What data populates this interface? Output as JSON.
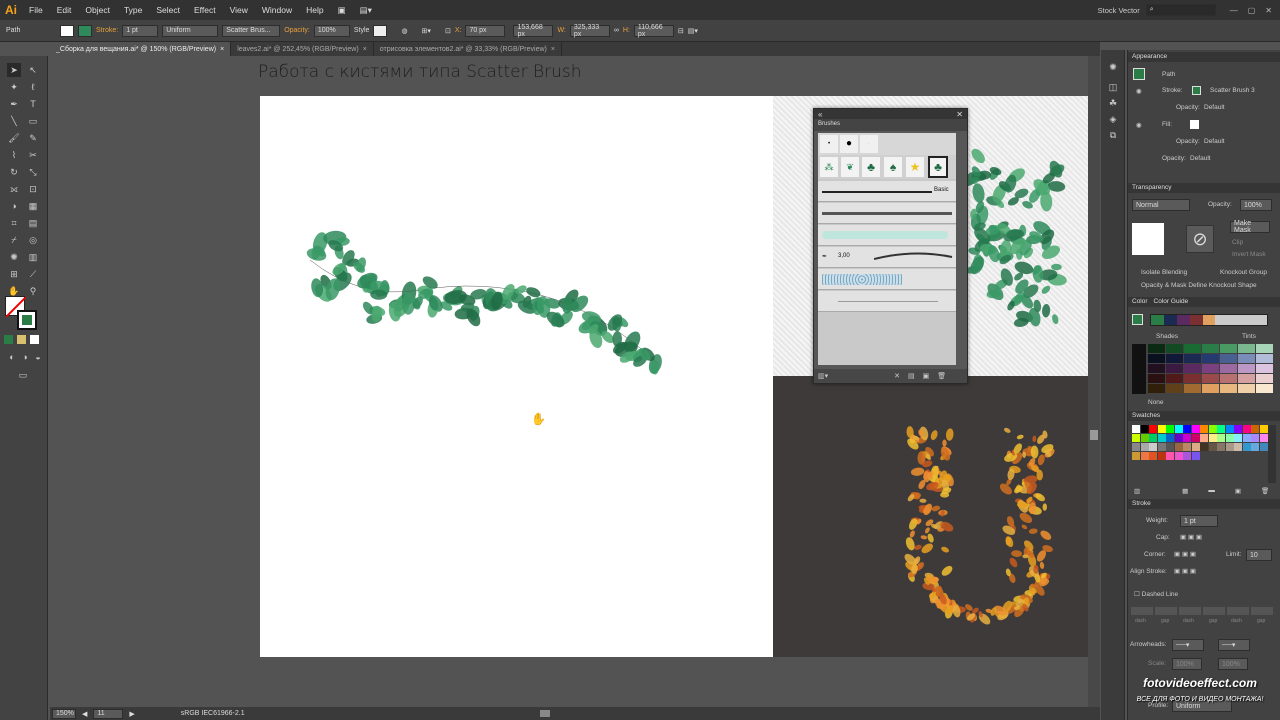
{
  "app": {
    "logo": "Ai"
  },
  "menu": [
    "File",
    "Edit",
    "Object",
    "Type",
    "Select",
    "Effect",
    "View",
    "Window",
    "Help"
  ],
  "workspace": "Stock Vector",
  "control": {
    "object_type": "Path",
    "stroke_label": "Stroke:",
    "stroke_weight": "1 pt",
    "profile": "Uniform",
    "brush": "Scatter Brus...",
    "opacity_label": "Opacity:",
    "opacity": "100%",
    "style_label": "Style",
    "x_label": "X:",
    "x": "70 px",
    "y": "153,668 px",
    "w_label": "W:",
    "w": "325,333 px",
    "h_label": "H:",
    "h": "110,666 px"
  },
  "tabs": [
    {
      "label": "_Сборка для вещания.ai* @ 150% (RGB/Preview)",
      "active": true
    },
    {
      "label": "leaves2.ai* @ 252,45% (RGB/Preview)",
      "active": false
    },
    {
      "label": "отрисовка элементов2.ai* @ 33,33% (RGB/Preview)",
      "active": false
    }
  ],
  "canvas": {
    "heading": "Работа с кистями типа Scatter Brush"
  },
  "brushes_panel": {
    "title": "Brushes",
    "basic_label": "Basic",
    "size_value": "3,00"
  },
  "appearance": {
    "title": "Appearance",
    "object": "Path",
    "stroke_label": "Stroke:",
    "stroke_value": "Scatter Brush 3",
    "opacity_label": "Opacity:",
    "opacity_value": "Default",
    "fill_label": "Fill:",
    "fill_opacity_label": "Opacity:",
    "fill_opacity_value": "Default",
    "opacity2_label": "Opacity:",
    "opacity2_value": "Default"
  },
  "transparency": {
    "title": "Transparency",
    "mode": "Normal",
    "opacity_label": "Opacity:",
    "opacity": "100%",
    "make_mask": "Make Mask",
    "clip": "Clip",
    "invert": "Invert Mask",
    "isolate": "Isolate Blending",
    "knockout": "Knockout Group",
    "opacity_mask": "Opacity & Mask Define Knockout Shape"
  },
  "color_guide": {
    "tab_color": "Color",
    "tab_guide": "Color Guide",
    "shades": "Shades",
    "tints": "Tints",
    "none": "None"
  },
  "swatches": {
    "title": "Swatches"
  },
  "stroke_panel": {
    "title": "Stroke",
    "weight_label": "Weight:",
    "weight": "1 pt",
    "cap_label": "Cap:",
    "corner_label": "Corner:",
    "limit_label": "Limit:",
    "limit": "10",
    "align_label": "Align Stroke:",
    "dashed_label": "Dashed Line",
    "dash_labels": [
      "dash",
      "gap",
      "dash",
      "gap",
      "dash",
      "gap"
    ],
    "arrowheads_label": "Arrowheads:",
    "scale_label": "Scale:",
    "scale1": "100%",
    "scale2": "100%",
    "profile_label": "Profile:",
    "profile": "Uniform"
  },
  "status": {
    "zoom": "150%",
    "page": "11",
    "profile": "sRGB IEC61966-2.1"
  },
  "watermark": {
    "line1": "fotovideoeffect.com",
    "line2": "ВСЕ ДЛЯ ФОТО И ВИДЕО МОНТАЖА!"
  },
  "colors": {
    "leaf_green": "#2e8a5a",
    "leaf_dark": "#1f6b44",
    "autumn_orange": "#e8a020",
    "autumn_red": "#c85a20",
    "accent": "#f7a21b"
  }
}
